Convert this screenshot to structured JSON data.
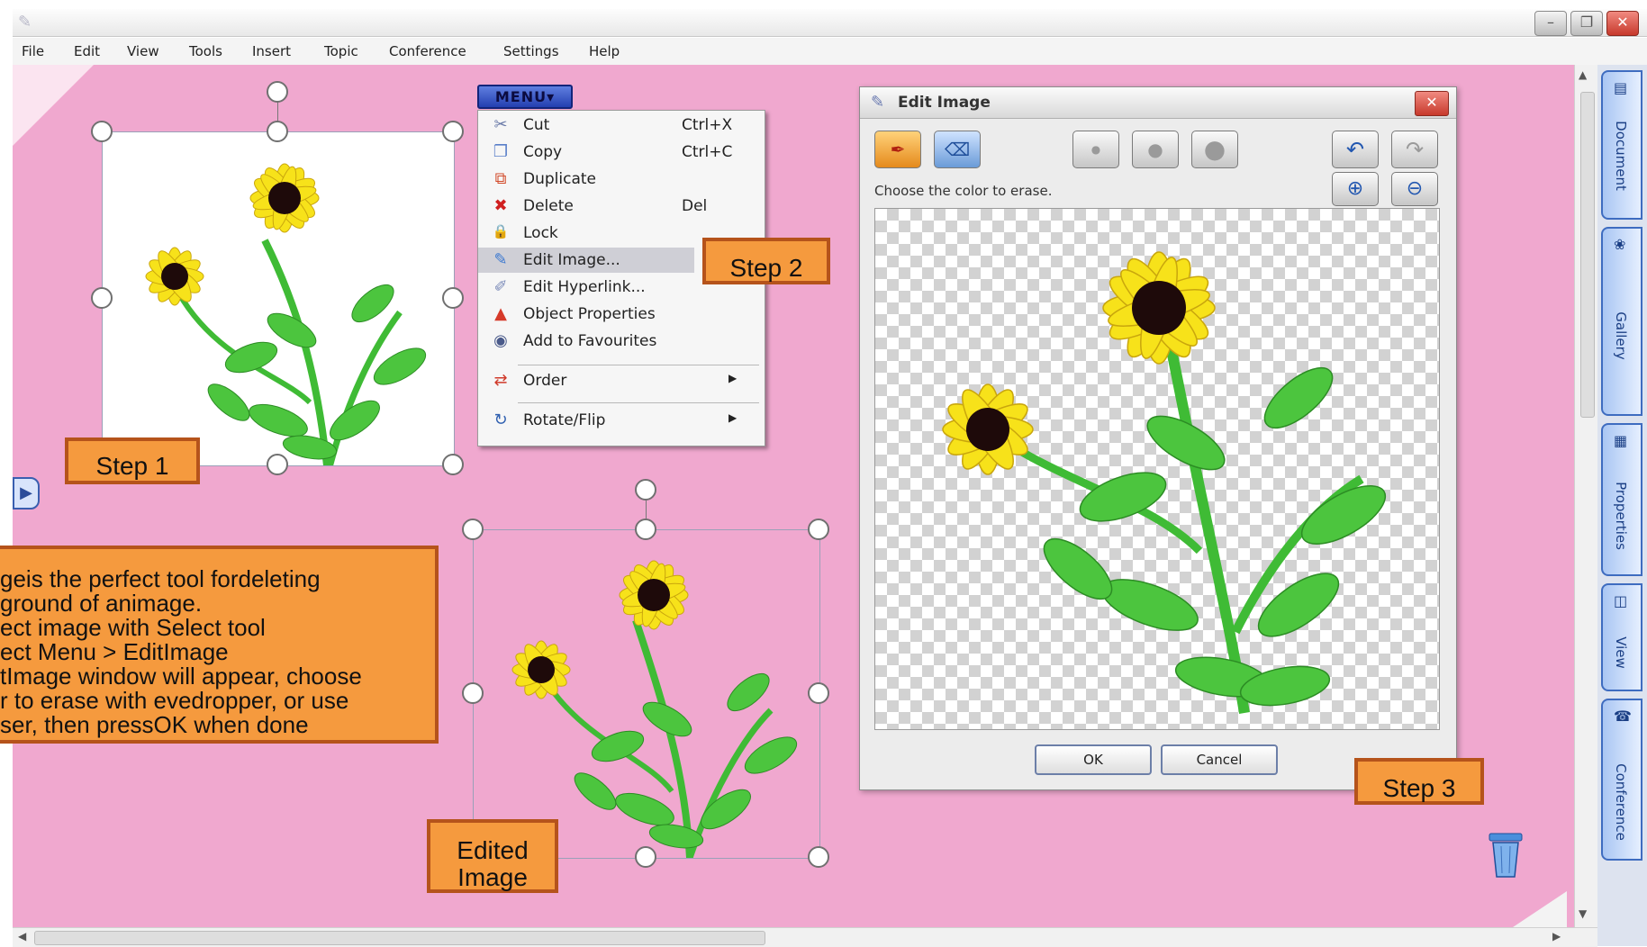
{
  "window": {
    "app_icon": "pencil-icon",
    "buttons": [
      {
        "name": "minimize-button",
        "glyph": "–"
      },
      {
        "name": "restore-button",
        "glyph": "❐"
      },
      {
        "name": "close-button",
        "glyph": "✕"
      }
    ]
  },
  "menubar": {
    "items": [
      "File",
      "Edit",
      "View",
      "Tools",
      "Insert",
      "Topic",
      "Conference",
      "Settings",
      "Help"
    ]
  },
  "menu_button": {
    "label": "MENU▾"
  },
  "context_menu": {
    "items": [
      {
        "label": "Cut",
        "shortcut": "Ctrl+X",
        "icon": "scissors-icon",
        "glyph": "✂",
        "color": "#6a7aa8"
      },
      {
        "label": "Copy",
        "shortcut": "Ctrl+C",
        "icon": "copy-icon",
        "glyph": "❐",
        "color": "#5a7fc9"
      },
      {
        "label": "Duplicate",
        "shortcut": "",
        "icon": "duplicate-icon",
        "glyph": "⧉",
        "color": "#d24a2a"
      },
      {
        "label": "Delete",
        "shortcut": "Del",
        "icon": "delete-icon",
        "glyph": "✖",
        "color": "#d02020"
      },
      {
        "label": "Lock",
        "shortcut": "",
        "icon": "lock-icon",
        "glyph": "🔒",
        "color": "#5d73b0"
      },
      {
        "label": "Edit Image...",
        "shortcut": "",
        "icon": "edit-image-icon",
        "glyph": "✎",
        "color": "#3b78d0",
        "highlighted": true
      },
      {
        "label": "Edit Hyperlink...",
        "shortcut": "",
        "icon": "hyperlink-icon",
        "glyph": "✐",
        "color": "#7a8ab8"
      },
      {
        "label": "Object Properties",
        "shortcut": "",
        "icon": "properties-icon",
        "glyph": "▲",
        "color": "#d63a2a"
      },
      {
        "label": "Add to Favourites",
        "shortcut": "",
        "icon": "favourites-icon",
        "glyph": "◉",
        "color": "#4a5a8a"
      }
    ],
    "submenus": [
      {
        "label": "Order",
        "icon": "order-icon",
        "glyph": "⇄",
        "color": "#d03a2a"
      },
      {
        "label": "Rotate/Flip",
        "icon": "rotate-icon",
        "glyph": "↻",
        "color": "#3060b0"
      }
    ]
  },
  "callouts": {
    "step1": "Step 1",
    "step2": "Step 2",
    "step3": "Step 3",
    "edited_line1": "Edited",
    "edited_line2": "Image",
    "instructions": [
      "geis the perfect tool fordeleting",
      "ground of animage.",
      "ect image with Select tool",
      "ect Menu > EditImage",
      "tImage window will appear, choose",
      "r to erase with evedropper, or use",
      "ser, then pressOK when done"
    ]
  },
  "edit_image_dialog": {
    "title": "Edit Image",
    "prompt": "Choose the color to erase.",
    "ok_label": "OK",
    "cancel_label": "Cancel",
    "tools": [
      {
        "name": "eyedropper-tool-button",
        "icon": "eyedropper-icon",
        "glyph": "✒"
      },
      {
        "name": "eraser-tool-button",
        "icon": "eraser-icon",
        "glyph": "⌫"
      },
      {
        "name": "small-brush-button",
        "icon": "small-brush-icon",
        "glyph": "●"
      },
      {
        "name": "medium-brush-button",
        "icon": "medium-brush-icon",
        "glyph": "●"
      },
      {
        "name": "large-brush-button",
        "icon": "large-brush-icon",
        "glyph": "●"
      },
      {
        "name": "undo-button",
        "icon": "undo-icon",
        "glyph": "↶"
      },
      {
        "name": "redo-button",
        "icon": "redo-icon",
        "glyph": "↷"
      },
      {
        "name": "zoom-in-button",
        "icon": "zoom-in-icon",
        "glyph": "⊕"
      },
      {
        "name": "zoom-out-button",
        "icon": "zoom-out-icon",
        "glyph": "⊖"
      }
    ]
  },
  "side_tabs": [
    "Document",
    "Gallery",
    "Properties",
    "View",
    "Conference"
  ],
  "colors": {
    "canvas_pink": "#f0a8cf",
    "callout_orange": "#f59a3e",
    "callout_border": "#b5531b",
    "petal_yellow": "#f7e21a",
    "leaf_green": "#4cc53e"
  }
}
